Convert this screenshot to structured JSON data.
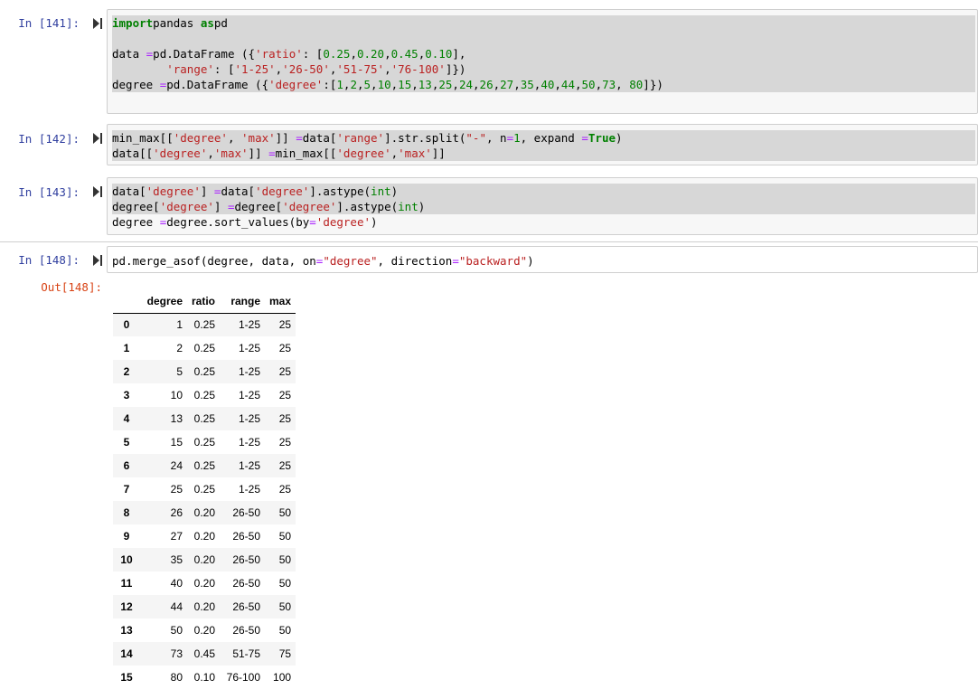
{
  "cells": [
    {
      "prompt": "In [141]:",
      "code_lines": [
        [
          [
            "kw",
            "import"
          ],
          [
            "",
            "pandas "
          ],
          [
            "kw",
            "as"
          ],
          [
            "",
            "pd"
          ]
        ],
        [],
        [
          [
            "",
            "data "
          ],
          [
            "op",
            "="
          ],
          [
            "",
            "pd.DataFrame ({"
          ],
          [
            "str",
            "'ratio'"
          ],
          [
            "",
            ": ["
          ],
          [
            "num",
            "0.25"
          ],
          [
            "",
            ","
          ],
          [
            "num",
            "0.20"
          ],
          [
            "",
            ","
          ],
          [
            "num",
            "0.45"
          ],
          [
            "",
            ","
          ],
          [
            "num",
            "0.10"
          ],
          [
            "",
            "],"
          ]
        ],
        [
          [
            "",
            "        "
          ],
          [
            "str",
            "'range'"
          ],
          [
            "",
            ": ["
          ],
          [
            "str",
            "'1-25'"
          ],
          [
            "",
            ","
          ],
          [
            "str",
            "'26-50'"
          ],
          [
            "",
            ","
          ],
          [
            "str",
            "'51-75'"
          ],
          [
            "",
            ","
          ],
          [
            "str",
            "'76-100'"
          ],
          [
            "",
            "]})"
          ]
        ],
        [
          [
            "",
            "degree "
          ],
          [
            "op",
            "="
          ],
          [
            "",
            "pd.DataFrame ({"
          ],
          [
            "str",
            "'degree'"
          ],
          [
            "",
            ":["
          ],
          [
            "num",
            "1"
          ],
          [
            "",
            ","
          ],
          [
            "num",
            "2"
          ],
          [
            "",
            ","
          ],
          [
            "num",
            "5"
          ],
          [
            "",
            ","
          ],
          [
            "num",
            "10"
          ],
          [
            "",
            ","
          ],
          [
            "num",
            "15"
          ],
          [
            "",
            ","
          ],
          [
            "num",
            "13"
          ],
          [
            "",
            ","
          ],
          [
            "num",
            "25"
          ],
          [
            "",
            ","
          ],
          [
            "num",
            "24"
          ],
          [
            "",
            ","
          ],
          [
            "num",
            "26"
          ],
          [
            "",
            ","
          ],
          [
            "num",
            "27"
          ],
          [
            "",
            ","
          ],
          [
            "num",
            "35"
          ],
          [
            "",
            ","
          ],
          [
            "num",
            "40"
          ],
          [
            "",
            ","
          ],
          [
            "num",
            "44"
          ],
          [
            "",
            ","
          ],
          [
            "num",
            "50"
          ],
          [
            "",
            ","
          ],
          [
            "num",
            "73"
          ],
          [
            "",
            ", "
          ],
          [
            "num",
            "80"
          ],
          [
            "",
            "]})"
          ]
        ]
      ]
    },
    {
      "prompt": "In [142]:",
      "code_lines": [
        [
          [
            "",
            "min_max[["
          ],
          [
            "str",
            "'degree'"
          ],
          [
            "",
            ", "
          ],
          [
            "str",
            "'max'"
          ],
          [
            "",
            "]] "
          ],
          [
            "op",
            "="
          ],
          [
            "",
            "data["
          ],
          [
            "str",
            "'range'"
          ],
          [
            "",
            "].str.split("
          ],
          [
            "str",
            "\"-\""
          ],
          [
            "",
            ", n"
          ],
          [
            "op",
            "="
          ],
          [
            "num",
            "1"
          ],
          [
            "",
            ", expand "
          ],
          [
            "op",
            "="
          ],
          [
            "kw",
            "True"
          ],
          [
            "",
            ")"
          ]
        ],
        [
          [
            "",
            "data[["
          ],
          [
            "str",
            "'degree'"
          ],
          [
            "",
            ","
          ],
          [
            "str",
            "'max'"
          ],
          [
            "",
            "]] "
          ],
          [
            "op",
            "="
          ],
          [
            "",
            "min_max[["
          ],
          [
            "str",
            "'degree'"
          ],
          [
            "",
            ","
          ],
          [
            "str",
            "'max'"
          ],
          [
            "",
            "]]"
          ]
        ]
      ]
    },
    {
      "prompt": "In [143]:",
      "code_lines": [
        [
          [
            "",
            "data["
          ],
          [
            "str",
            "'degree'"
          ],
          [
            "",
            "] "
          ],
          [
            "op",
            "="
          ],
          [
            "",
            "data["
          ],
          [
            "str",
            "'degree'"
          ],
          [
            "",
            "].astype("
          ],
          [
            "num",
            "int"
          ],
          [
            "",
            ")"
          ]
        ],
        [
          [
            "",
            "degree["
          ],
          [
            "str",
            "'degree'"
          ],
          [
            "",
            "] "
          ],
          [
            "op",
            "="
          ],
          [
            "",
            "degree["
          ],
          [
            "str",
            "'degree'"
          ],
          [
            "",
            "].astype("
          ],
          [
            "num",
            "int"
          ],
          [
            "",
            ")"
          ]
        ],
        [
          [
            "",
            "degree "
          ],
          [
            "op",
            "="
          ],
          [
            "",
            "degree.sort_values(by"
          ],
          [
            "op",
            "="
          ],
          [
            "str",
            "'degree'"
          ],
          [
            "",
            ")"
          ]
        ]
      ]
    },
    {
      "prompt": "In [148]:",
      "code_lines": [
        [
          [
            "",
            "pd.merge_asof(degree, data, on"
          ],
          [
            "op",
            "="
          ],
          [
            "str",
            "\"degree\""
          ],
          [
            "",
            ", direction"
          ],
          [
            "op",
            "="
          ],
          [
            "str",
            "\"backward\""
          ],
          [
            "",
            ")"
          ]
        ]
      ]
    }
  ],
  "output": {
    "prompt": "Out[148]:",
    "columns": [
      "degree",
      "ratio",
      "range",
      "max"
    ],
    "rows": [
      [
        "0",
        "1",
        "0.25",
        "1-25",
        "25"
      ],
      [
        "1",
        "2",
        "0.25",
        "1-25",
        "25"
      ],
      [
        "2",
        "5",
        "0.25",
        "1-25",
        "25"
      ],
      [
        "3",
        "10",
        "0.25",
        "1-25",
        "25"
      ],
      [
        "4",
        "13",
        "0.25",
        "1-25",
        "25"
      ],
      [
        "5",
        "15",
        "0.25",
        "1-25",
        "25"
      ],
      [
        "6",
        "24",
        "0.25",
        "1-25",
        "25"
      ],
      [
        "7",
        "25",
        "0.25",
        "1-25",
        "25"
      ],
      [
        "8",
        "26",
        "0.20",
        "26-50",
        "50"
      ],
      [
        "9",
        "27",
        "0.20",
        "26-50",
        "50"
      ],
      [
        "10",
        "35",
        "0.20",
        "26-50",
        "50"
      ],
      [
        "11",
        "40",
        "0.20",
        "26-50",
        "50"
      ],
      [
        "12",
        "44",
        "0.20",
        "26-50",
        "50"
      ],
      [
        "13",
        "50",
        "0.20",
        "26-50",
        "50"
      ],
      [
        "14",
        "73",
        "0.45",
        "51-75",
        "75"
      ],
      [
        "15",
        "80",
        "0.10",
        "76-100",
        "100"
      ]
    ]
  },
  "colors": {
    "prompt_in": "#303f9f",
    "prompt_out": "#d84315",
    "keyword": "#008000",
    "string": "#ba2121",
    "operator": "#aa22ff"
  },
  "icons": {
    "run": "run-cell-icon"
  }
}
